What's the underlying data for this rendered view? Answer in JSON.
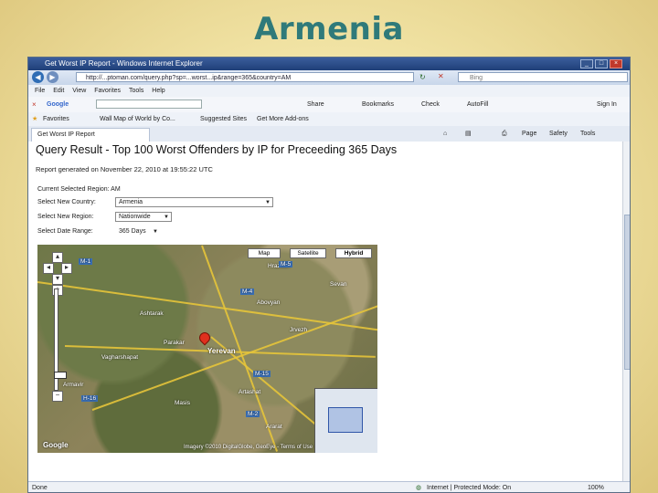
{
  "slide": {
    "title": "Armenia"
  },
  "browser": {
    "window_title": "Get Worst IP Report - Windows Internet Explorer",
    "url": "http://...ptoman.com/query.php?sp=...worst...ip&range=365&country=AM",
    "search_placeholder": "Bing",
    "menu": [
      "File",
      "Edit",
      "View",
      "Favorites",
      "Tools",
      "Help"
    ],
    "google_bar": {
      "label": "Google",
      "items": [
        "Share",
        "Bookmarks",
        "Check",
        "AutoFill"
      ],
      "signin": "Sign In"
    },
    "favorites": {
      "label": "Favorites",
      "items": [
        "Wall Map of World by Co...",
        "Suggested Sites",
        "Get More Add-ons"
      ]
    },
    "tab_label": "Get Worst IP Report",
    "tab_tools": [
      "Page",
      "Safety",
      "Tools"
    ],
    "status": {
      "left": "Done",
      "zone": "Internet | Protected Mode: On",
      "zoom": "100%"
    }
  },
  "page": {
    "heading": "Query Result - Top 100 Worst Offenders by IP for Preceeding 365 Days",
    "report_generated": "Report generated on November 22, 2010 at 19:55:22 UTC",
    "form": {
      "current_region_label": "Current Selected Region:",
      "current_region_value": "AM",
      "country_label": "Select New Country:",
      "country_value": "Armenia",
      "region_label": "Select New Region:",
      "region_value": "Nationwide",
      "range_label": "Select Date Range:",
      "range_value": "365 Days"
    }
  },
  "map": {
    "types": [
      "Map",
      "Satellite",
      "Hybrid"
    ],
    "active_type": "Hybrid",
    "places": [
      "Ashtarak",
      "Yerevan",
      "Abovyan",
      "Artashat",
      "Armavir",
      "Masis",
      "Vagharshapat",
      "Hrazdan",
      "Sevan",
      "Ararat",
      "Parakar",
      "Jrvezh"
    ],
    "route_labels": [
      "M-1",
      "M-4",
      "M-5",
      "M-15",
      "H-16",
      "M-2"
    ],
    "copyright": "Imagery ©2010 DigitalGlobe, GeoEye - Terms of Use",
    "logo": "Google"
  },
  "colors": {
    "title_teal": "#2f7a7a",
    "slide_bg": "#f1e3a4",
    "ie_titlebar": "#1f3f78",
    "map_pin": "#e0301e"
  }
}
